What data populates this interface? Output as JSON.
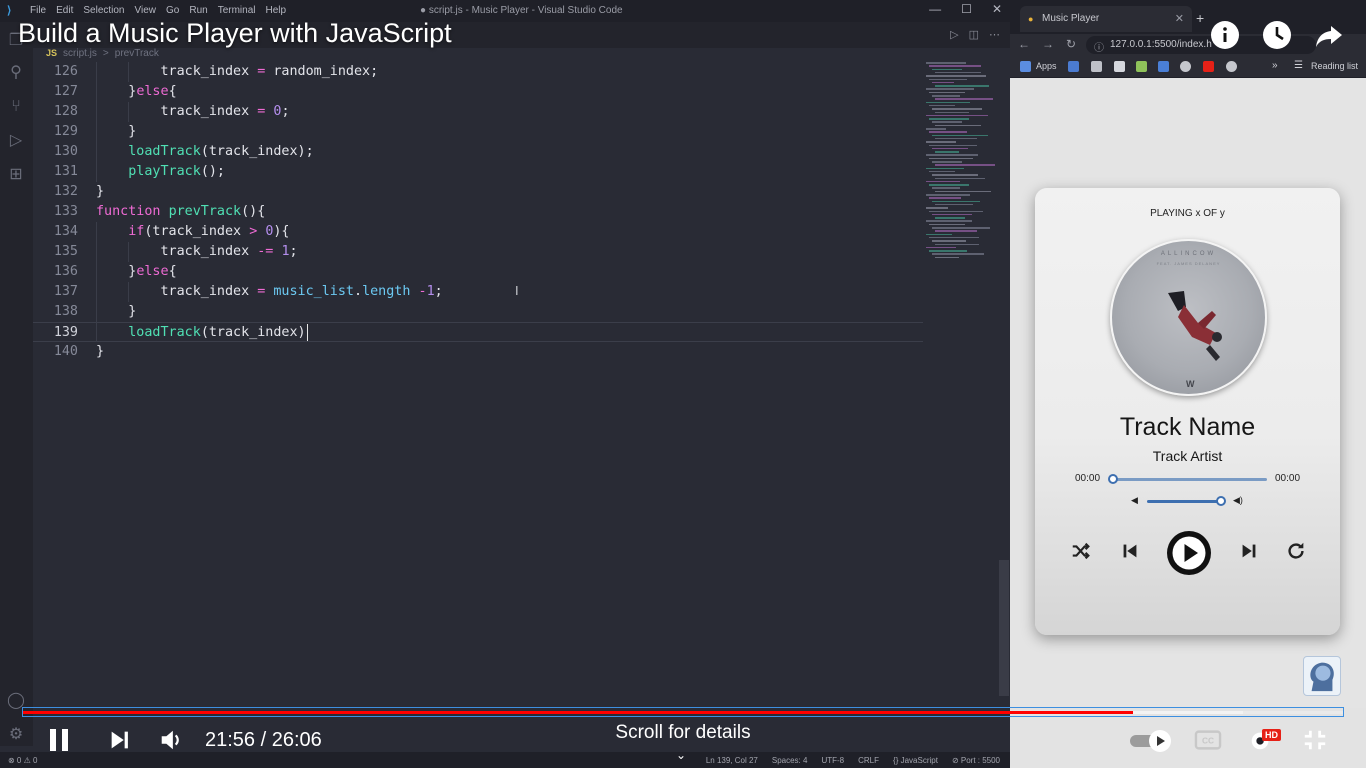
{
  "video": {
    "title": "Build a Music Player with JavaScript",
    "current_time": "21:56",
    "duration": "26:06",
    "time_display": "21:56 / 26:06",
    "progress_fraction": 0.841,
    "buffered_fraction": 0.924,
    "scroll_hint": "Scroll for details",
    "hd_badge": "HD"
  },
  "vscode": {
    "menu": [
      "File",
      "Edit",
      "Selection",
      "View",
      "Go",
      "Run",
      "Terminal",
      "Help"
    ],
    "window_title": "● script.js - Music Player - Visual Studio Code",
    "breadcrumb": {
      "file_type": "JS",
      "file": "script.js",
      "separator": ">",
      "symbol": "prevTrack"
    },
    "code_lines": [
      {
        "num": "126",
        "indent": "        ",
        "tokens": [
          [
            "pl",
            "track_index "
          ],
          [
            "op",
            "="
          ],
          [
            "pl",
            " random_index;"
          ]
        ]
      },
      {
        "num": "127",
        "indent": "    ",
        "tokens": [
          [
            "pl",
            "}"
          ],
          [
            "kw",
            "else"
          ],
          [
            "pl",
            "{"
          ]
        ]
      },
      {
        "num": "128",
        "indent": "        ",
        "tokens": [
          [
            "pl",
            "track_index "
          ],
          [
            "op",
            "="
          ],
          [
            "pl",
            " "
          ],
          [
            "num",
            "0"
          ],
          [
            "pl",
            ";"
          ]
        ]
      },
      {
        "num": "129",
        "indent": "    ",
        "tokens": [
          [
            "pl",
            "}"
          ]
        ]
      },
      {
        "num": "130",
        "indent": "    ",
        "tokens": [
          [
            "fn",
            "loadTrack"
          ],
          [
            "pl",
            "(track_index);"
          ]
        ]
      },
      {
        "num": "131",
        "indent": "    ",
        "tokens": [
          [
            "fn",
            "playTrack"
          ],
          [
            "pl",
            "();"
          ]
        ]
      },
      {
        "num": "132",
        "indent": "",
        "tokens": [
          [
            "pl",
            "}"
          ]
        ]
      },
      {
        "num": "133",
        "indent": "",
        "tokens": [
          [
            "kw",
            "function"
          ],
          [
            "pl",
            " "
          ],
          [
            "fn",
            "prevTrack"
          ],
          [
            "pl",
            "(){"
          ]
        ]
      },
      {
        "num": "134",
        "indent": "    ",
        "tokens": [
          [
            "kw",
            "if"
          ],
          [
            "pl",
            "(track_index "
          ],
          [
            "op",
            ">"
          ],
          [
            "pl",
            " "
          ],
          [
            "num",
            "0"
          ],
          [
            "pl",
            "){"
          ]
        ]
      },
      {
        "num": "135",
        "indent": "        ",
        "tokens": [
          [
            "pl",
            "track_index "
          ],
          [
            "op",
            "-="
          ],
          [
            "pl",
            " "
          ],
          [
            "num",
            "1"
          ],
          [
            "pl",
            ";"
          ]
        ]
      },
      {
        "num": "136",
        "indent": "    ",
        "tokens": [
          [
            "pl",
            "}"
          ],
          [
            "kw",
            "else"
          ],
          [
            "pl",
            "{"
          ]
        ]
      },
      {
        "num": "137",
        "indent": "        ",
        "tokens": [
          [
            "pl",
            "track_index "
          ],
          [
            "op",
            "="
          ],
          [
            "pl",
            " "
          ],
          [
            "prop",
            "music_list"
          ],
          [
            "pl",
            "."
          ],
          [
            "prop",
            "length"
          ],
          [
            "pl",
            " "
          ],
          [
            "op",
            "-"
          ],
          [
            "num",
            "1"
          ],
          [
            "pl",
            ";"
          ]
        ]
      },
      {
        "num": "138",
        "indent": "    ",
        "tokens": [
          [
            "pl",
            "}"
          ]
        ]
      },
      {
        "num": "139",
        "indent": "    ",
        "tokens": [
          [
            "fn",
            "loadTrack"
          ],
          [
            "pl",
            "(track_index)"
          ]
        ]
      },
      {
        "num": "140",
        "indent": "",
        "tokens": [
          [
            "pl",
            "}"
          ]
        ]
      }
    ],
    "active_line": "139",
    "status": {
      "problems": "⊗ 0 ⚠ 0",
      "items": [
        "Ln 139, Col 27",
        "Spaces: 4",
        "UTF-8",
        "CRLF",
        "{} JavaScript",
        "⊘ Port : 5500"
      ]
    }
  },
  "browser": {
    "tab_title": "Music Player",
    "url": "127.0.0.1:5500/index.h",
    "bookmarks_apps": "Apps",
    "reading_list": "Reading list"
  },
  "player": {
    "now_playing": "PLAYING x OF y",
    "album_title": "ALLINCOW",
    "album_subtitle": "FEAT. JAMES DELANEY",
    "album_mark": "W",
    "track_name": "Track Name",
    "track_artist": "Track Artist",
    "current_time": "00:00",
    "total_time": "00:00",
    "seek_fraction": 0.0,
    "volume_fraction": 1.0
  }
}
